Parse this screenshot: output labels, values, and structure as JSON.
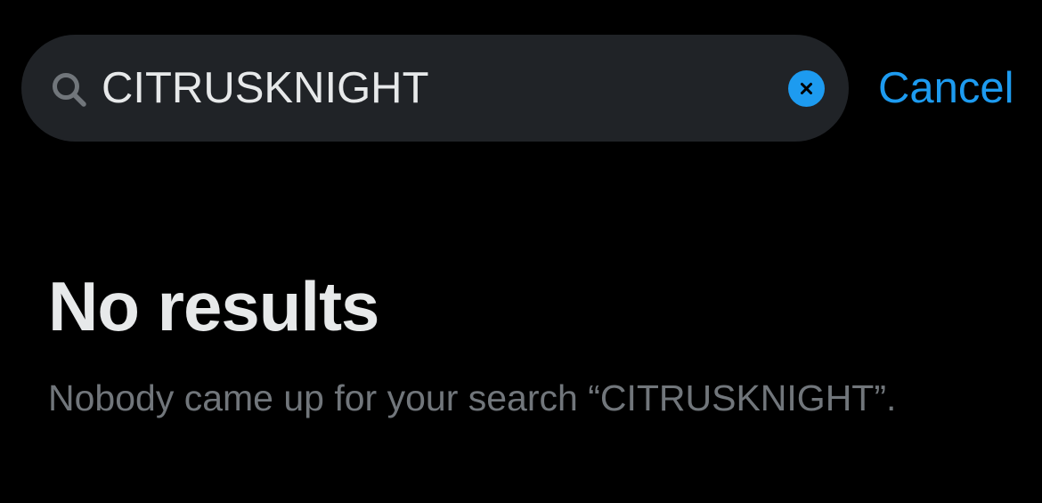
{
  "search": {
    "value": "CITRUSKNIGHT",
    "search_icon": "search-icon",
    "clear_icon": "close-icon"
  },
  "header": {
    "cancel_label": "Cancel"
  },
  "results": {
    "title": "No results",
    "message": "Nobody came up for your search “CITRUSKNIGHT”."
  },
  "colors": {
    "background": "#000000",
    "search_bar": "#202327",
    "accent": "#1d9bf0",
    "primary_text": "#e7e9ea",
    "secondary_text": "#71767b"
  }
}
